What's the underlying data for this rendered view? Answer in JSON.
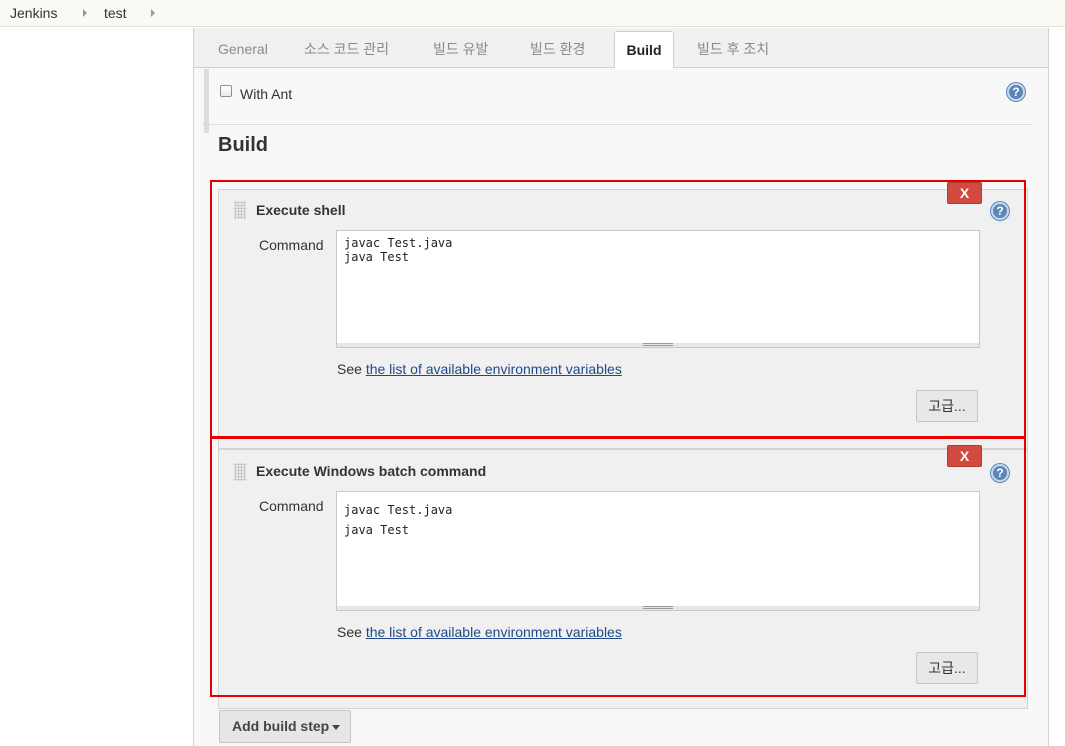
{
  "breadcrumb": {
    "items": [
      "Jenkins",
      "test"
    ]
  },
  "tabs": [
    "General",
    "소스 코드 관리",
    "빌드 유발",
    "빌드 환경",
    "Build",
    "빌드 후 조치"
  ],
  "active_tab": "Build",
  "env": {
    "with_ant_label": "With Ant",
    "with_ant_checked": false
  },
  "help_icon_glyph": "?",
  "section_title": "Build",
  "steps": [
    {
      "title": "Execute shell",
      "delete_label": "X",
      "command_label": "Command",
      "command_value": "javac Test.java\njava Test",
      "see_prefix": "See ",
      "see_link": "the list of available environment variables",
      "advanced_label": "고급..."
    },
    {
      "title": "Execute Windows batch command",
      "delete_label": "X",
      "command_label": "Command",
      "command_value": "javac Test.java\njava Test",
      "see_prefix": "See ",
      "see_link": "the list of available environment variables",
      "advanced_label": "고급..."
    }
  ],
  "add_build_step_label": "Add build step",
  "colors": {
    "highlight": "#e60000",
    "delete": "#d24a3f",
    "link": "#204a87",
    "help": "#5b86b8"
  }
}
